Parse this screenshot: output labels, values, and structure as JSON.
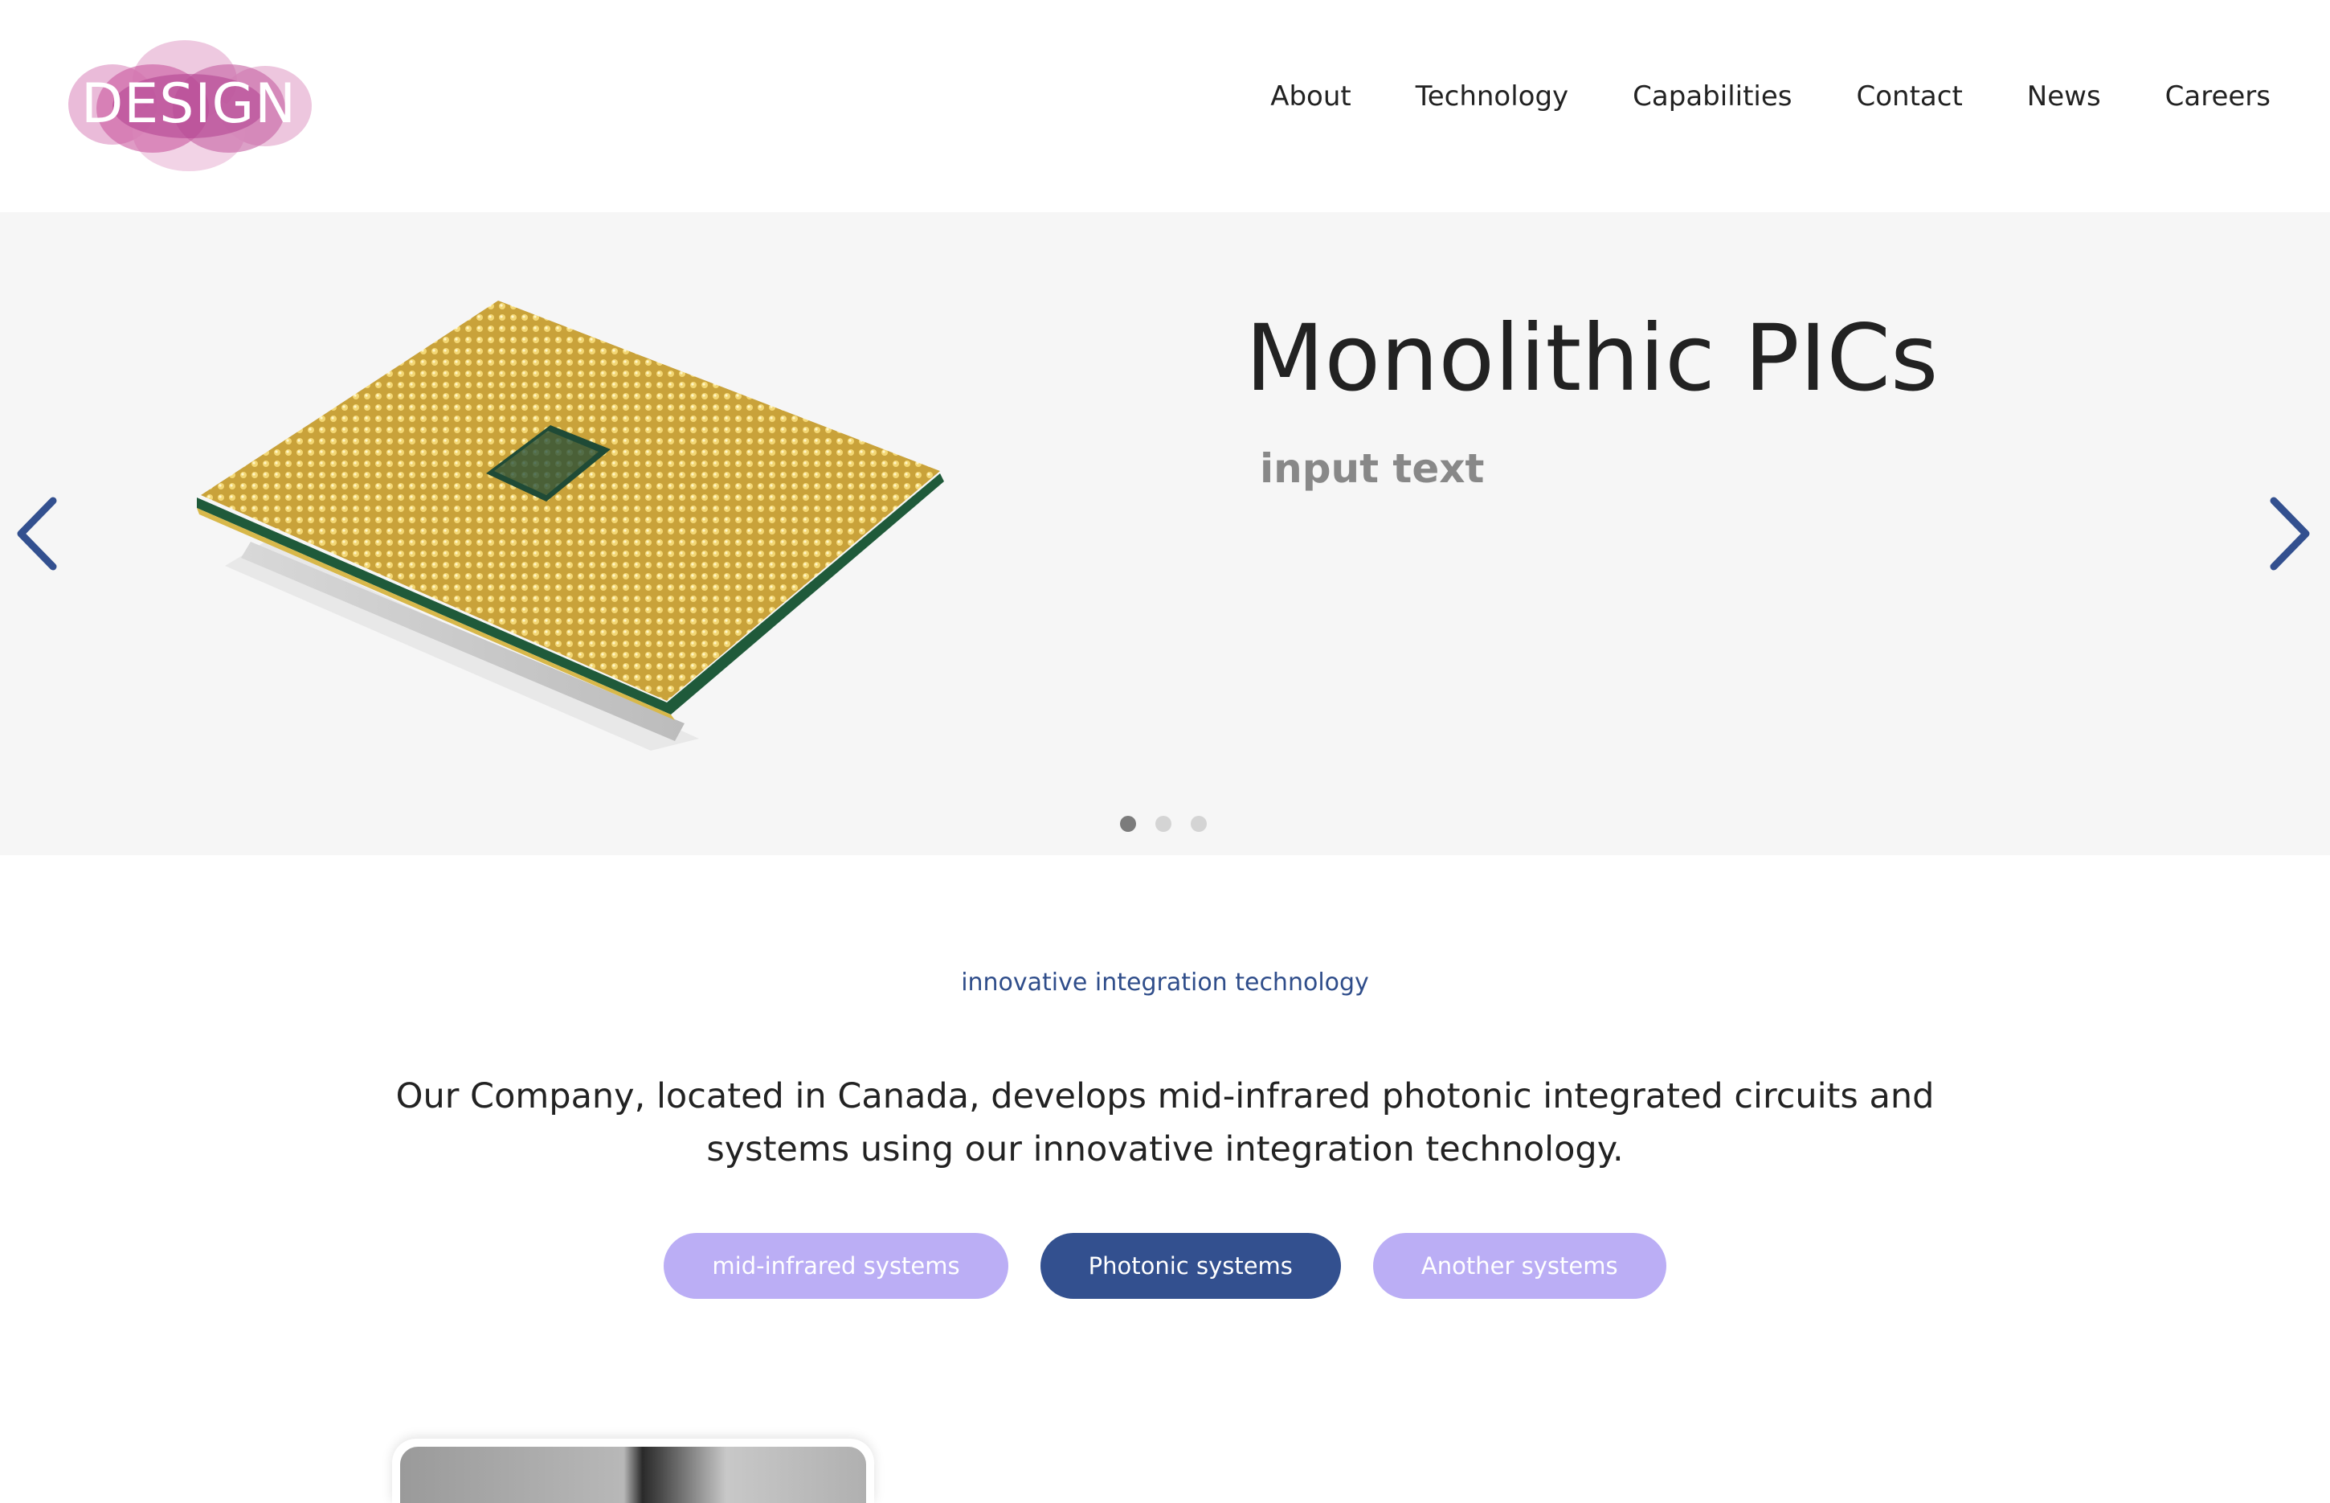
{
  "header": {
    "logo_text": "DESIGN",
    "nav": [
      {
        "label": "About"
      },
      {
        "label": "Technology"
      },
      {
        "label": "Capabilities"
      },
      {
        "label": "Contact"
      },
      {
        "label": "News"
      },
      {
        "label": "Careers"
      }
    ]
  },
  "hero": {
    "title": "Monolithic PICs",
    "subtitle": "input text",
    "image": "cpu-chip-image",
    "prev_icon": "chevron-left-icon",
    "next_icon": "chevron-right-icon",
    "slide_count": 3,
    "active_slide": 1
  },
  "intro": {
    "tagline": "innovative integration technology",
    "description": "Our Company, located in Canada, develops mid-infrared photonic integrated circuits and systems using our innovative integration technology."
  },
  "pills": [
    {
      "label": "mid-infrared systems",
      "active": false
    },
    {
      "label": "Photonic systems",
      "active": true
    },
    {
      "label": "Another systems",
      "active": false
    }
  ],
  "colors": {
    "accent_blue": "#33508f",
    "tagline_blue": "#2f4d8a",
    "pill_lavender": "#bbaef5",
    "logo_magenta": "#b0408f",
    "hero_bg": "#f6f6f6"
  }
}
